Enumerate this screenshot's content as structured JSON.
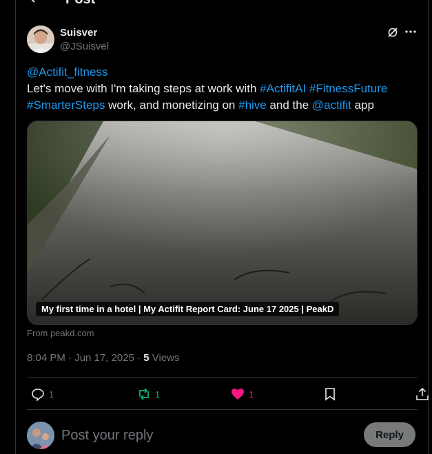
{
  "topbar": {
    "title": "Post"
  },
  "post": {
    "author_name": "Suisver",
    "author_handle": "@JSuisvel",
    "text": {
      "mention_top": "@Actifit_fitness",
      "line1_plain": "Let's move with I'm taking steps at work with ",
      "tag1": "#ActifitAI",
      "tag2": "#FitnessFuture",
      "tag3": "#SmarterSteps",
      "mid_plain": " work, and monetizing on ",
      "tag4": "#hive",
      "and_the": " and the ",
      "mention_app": "@actifit",
      "end_plain": " app"
    },
    "card": {
      "caption": "My first time in a hotel | My Actifit Report Card: June 17 2025 | PeakD",
      "source": "From peakd.com"
    },
    "meta": {
      "time": "8:04 PM · Jun 17, 2025 · ",
      "views_count": "5",
      "views_label": " Views"
    },
    "actions": {
      "replies": "1",
      "reposts": "1",
      "likes": "1"
    }
  },
  "reply": {
    "placeholder": "Post your reply",
    "button_label": "Reply"
  },
  "colors": {
    "accent": "#1d9bf0",
    "like": "#f91880",
    "repost": "#00ba7c",
    "muted": "#71767b"
  }
}
